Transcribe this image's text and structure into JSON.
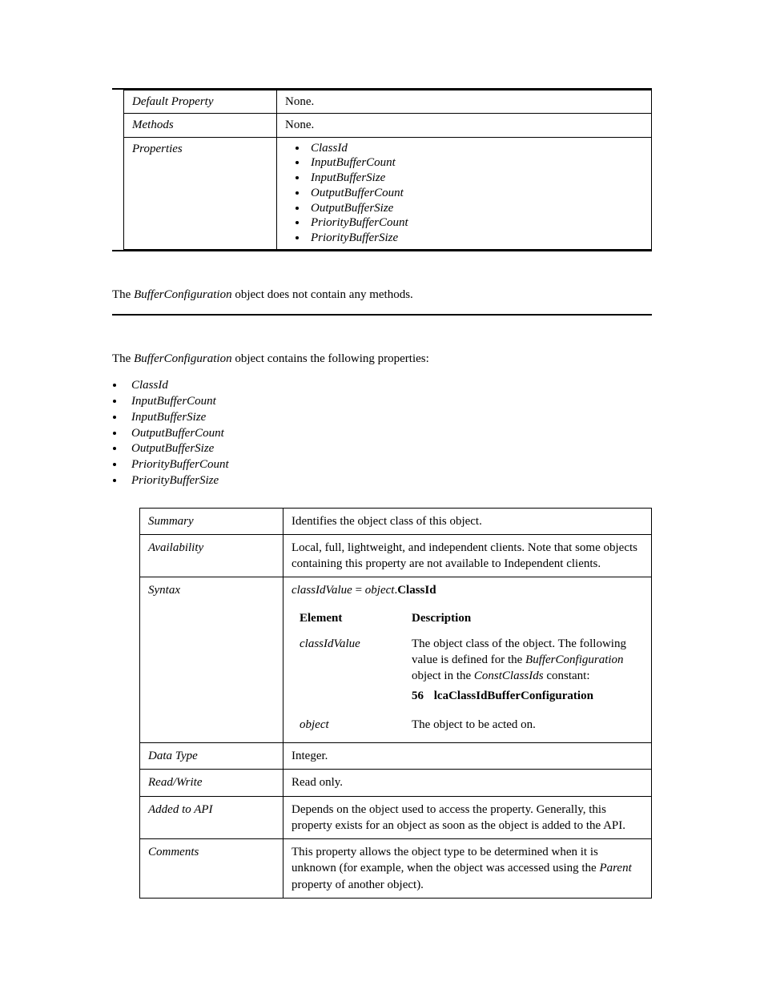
{
  "table1": {
    "rows": [
      {
        "label": "Default Property",
        "value": "None."
      },
      {
        "label": "Methods",
        "value": "None."
      }
    ],
    "propRowLabel": "Properties",
    "properties": [
      "ClassId",
      "InputBufferCount",
      "InputBufferSize",
      "OutputBufferCount",
      "OutputBufferSize",
      "PriorityBufferCount",
      "PriorityBufferSize"
    ]
  },
  "para1_pre": "The ",
  "para1_obj": "BufferConfiguration",
  "para1_post": " object does not contain any methods.",
  "para2_pre": "The ",
  "para2_obj": "BufferConfiguration",
  "para2_post": " object contains the following properties:",
  "bodyProperties": [
    "ClassId",
    "InputBufferCount",
    "InputBufferSize",
    "OutputBufferCount",
    "OutputBufferSize",
    "PriorityBufferCount",
    "PriorityBufferSize"
  ],
  "table2": {
    "summaryLabel": "Summary",
    "summaryValue": "Identifies the object class of this object.",
    "availLabel": "Availability",
    "availValue": "Local, full, lightweight, and independent clients. Note that some objects containing this property are not available to Independent clients.",
    "syntaxLabel": "Syntax",
    "syntaxExpr_lhs": "classIdValue",
    "syntaxExpr_eq": " = ",
    "syntaxExpr_obj": "object",
    "syntaxExpr_dot": ".",
    "syntaxExpr_prop": "ClassId",
    "elHead": "Element",
    "descHead": "Description",
    "row1_el": "classIdValue",
    "row1_desc_a": "The object class of the object.  The following value is defined for the ",
    "row1_desc_b": "BufferConfiguration",
    "row1_desc_c": " object in the ",
    "row1_desc_d": "ConstClassIds",
    "row1_desc_e": " constant:",
    "const_num": "56",
    "const_name": "lcaClassIdBufferConfiguration",
    "row2_el": "object",
    "row2_desc": "The object to be acted on.",
    "dtLabel": "Data Type",
    "dtValue": "Integer.",
    "rwLabel": "Read/Write",
    "rwValue": "Read only.",
    "apiLabel": "Added to API",
    "apiValue": "Depends on the object used to access the property. Generally, this property exists for an object as soon as the object is added to the API.",
    "commLabel": "Comments",
    "comm_a": "This property allows the object type to be determined when it is unknown (for example, when the object was accessed using the ",
    "comm_b": "Parent",
    "comm_c": " property of another object)."
  }
}
